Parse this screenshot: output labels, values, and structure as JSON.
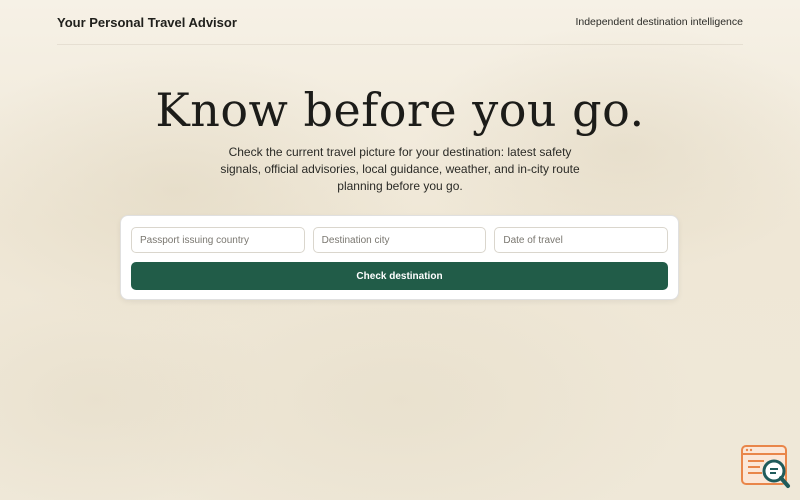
{
  "header": {
    "brand": "Your Personal Travel Advisor",
    "tagline": "Independent destination intelligence"
  },
  "hero": {
    "title": "Know before you go.",
    "subtitle": "Check the current travel picture for your destination: latest safety signals, official advisories, local guidance, weather, and in-city route planning before you go."
  },
  "form": {
    "passport": {
      "placeholder": "Passport issuing country",
      "value": ""
    },
    "destination": {
      "placeholder": "Destination city",
      "value": ""
    },
    "date": {
      "placeholder": "Date of travel",
      "value": ""
    },
    "submit_label": "Check destination"
  },
  "widget": {
    "icon": "search-chat-icon"
  },
  "colors": {
    "accent": "#215c48",
    "widget_orange": "#e9864a",
    "widget_teal": "#1f5b5b"
  }
}
